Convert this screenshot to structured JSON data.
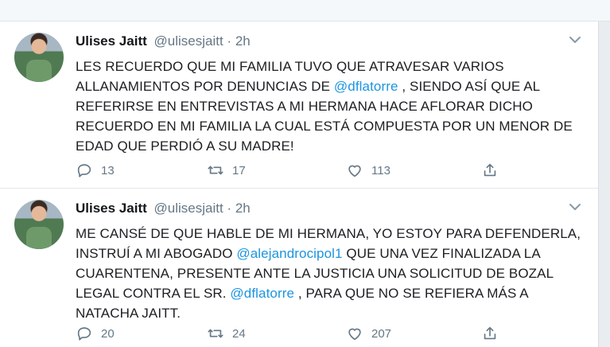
{
  "tweets": [
    {
      "name": "Ulises Jaitt",
      "handle": "@ulisesjaitt",
      "sep": "·",
      "time": "2h",
      "text_parts": [
        "LES RECUERDO QUE MI FAMILIA TUVO QUE ATRAVESAR VARIOS ALLANAMIENTOS POR DENUNCIAS DE ",
        "@dflatorre",
        " , SIENDO ASÍ QUE AL REFERIRSE EN ENTREVISTAS A MI HERMANA HACE AFLORAR DICHO RECUERDO EN MI FAMILIA LA CUAL ESTÁ COMPUESTA POR UN MENOR DE EDAD QUE PERDIÓ A SU MADRE!"
      ],
      "replies": "13",
      "retweets": "17",
      "likes": "113"
    },
    {
      "name": "Ulises Jaitt",
      "handle": "@ulisesjaitt",
      "sep": "·",
      "time": "2h",
      "text_parts": [
        "ME CANSÉ DE QUE HABLE DE MI HERMANA, YO ESTOY PARA DEFENDERLA, INSTRUÍ A MI ABOGADO ",
        "@alejandrocipol1",
        " QUE UNA VEZ FINALIZADA LA CUARENTENA,  PRESENTE ANTE LA JUSTICIA UNA SOLICITUD DE BOZAL LEGAL CONTRA EL SR. ",
        "@dflatorre",
        " , PARA QUE NO SE REFIERA MÁS A NATACHA JAITT."
      ],
      "replies": "20",
      "retweets": "24",
      "likes": "207"
    }
  ],
  "icons": {
    "reply": "reply-icon",
    "retweet": "retweet-icon",
    "like": "like-icon",
    "share": "share-icon",
    "more": "chevron-down-icon"
  },
  "colors": {
    "link": "#1b95e0",
    "muted": "#657786"
  }
}
